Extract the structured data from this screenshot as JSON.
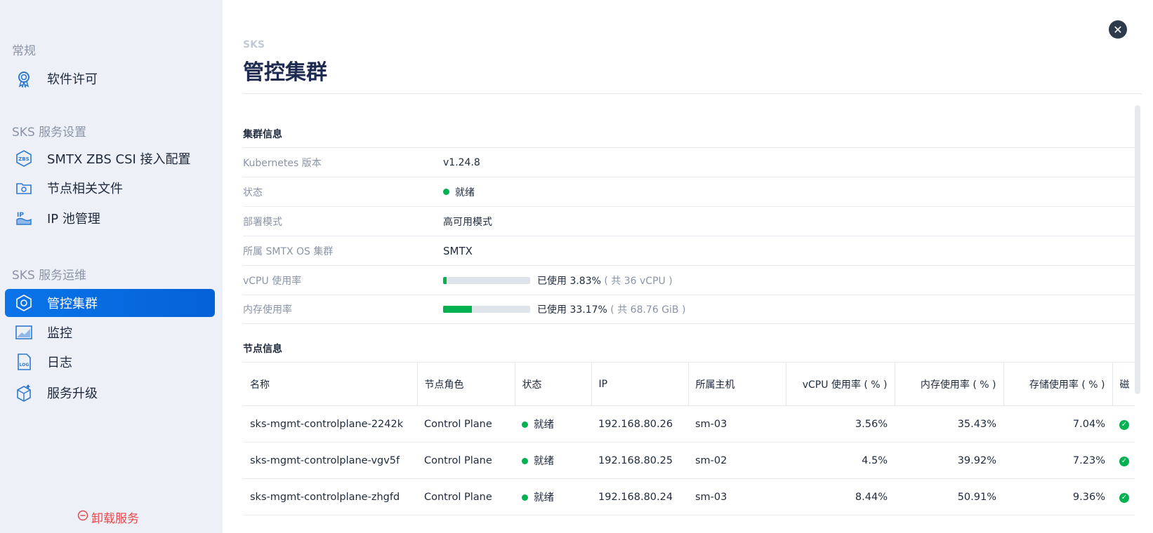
{
  "sidebar": {
    "sections": [
      {
        "title": "常规",
        "items": [
          {
            "label": "软件许可",
            "icon": "license-icon"
          }
        ]
      },
      {
        "title": "SKS 服务设置",
        "items": [
          {
            "label": "SMTX ZBS CSI 接入配置",
            "icon": "zbs-icon"
          },
          {
            "label": "节点相关文件",
            "icon": "folder-icon"
          },
          {
            "label": "IP 池管理",
            "icon": "ip-pool-icon"
          }
        ]
      },
      {
        "title": "SKS 服务运维",
        "items": [
          {
            "label": "管控集群",
            "icon": "cluster-icon",
            "active": true
          },
          {
            "label": "监控",
            "icon": "monitor-icon"
          },
          {
            "label": "日志",
            "icon": "log-icon"
          },
          {
            "label": "服务升级",
            "icon": "upgrade-icon"
          }
        ]
      }
    ],
    "uninstall_label": "卸载服务"
  },
  "header": {
    "breadcrumb": "SKS",
    "title": "管控集群",
    "close_icon": "close-icon"
  },
  "cluster_info": {
    "title": "集群信息",
    "rows": {
      "k8s_version": {
        "label": "Kubernetes 版本",
        "value": "v1.24.8"
      },
      "status": {
        "label": "状态",
        "value": "就绪"
      },
      "deploy_mode": {
        "label": "部署模式",
        "value": "高可用模式"
      },
      "os_cluster": {
        "label": "所属 SMTX OS 集群",
        "value": "SMTX"
      },
      "vcpu": {
        "label": "vCPU 使用率",
        "used_text": "已使用 3.83%",
        "total_text": "( 共 36 vCPU )",
        "percent": 3.83
      },
      "memory": {
        "label": "内存使用率",
        "used_text": "已使用 33.17%",
        "total_text": "( 共 68.76 GiB )",
        "percent": 33.17
      }
    }
  },
  "node_info": {
    "title": "节点信息",
    "columns": [
      "名称",
      "节点角色",
      "状态",
      "IP",
      "所属主机",
      "vCPU 使用率 ( % )",
      "内存使用率 ( % )",
      "存储使用率 ( % )",
      "磁"
    ],
    "rows": [
      {
        "name": "sks-mgmt-controlplane-2242k",
        "role": "Control Plane",
        "status": "就绪",
        "ip": "192.168.80.26",
        "host": "sm-03",
        "vcpu": "3.56%",
        "mem": "35.43%",
        "storage": "7.04%"
      },
      {
        "name": "sks-mgmt-controlplane-vgv5f",
        "role": "Control Plane",
        "status": "就绪",
        "ip": "192.168.80.25",
        "host": "sm-02",
        "vcpu": "4.5%",
        "mem": "39.92%",
        "storage": "7.23%"
      },
      {
        "name": "sks-mgmt-controlplane-zhgfd",
        "role": "Control Plane",
        "status": "就绪",
        "ip": "192.168.80.24",
        "host": "sm-03",
        "vcpu": "8.44%",
        "mem": "50.91%",
        "storage": "9.36%"
      }
    ]
  },
  "colors": {
    "accent": "#0a74e8",
    "success": "#00b14f",
    "danger": "#e5484d"
  }
}
